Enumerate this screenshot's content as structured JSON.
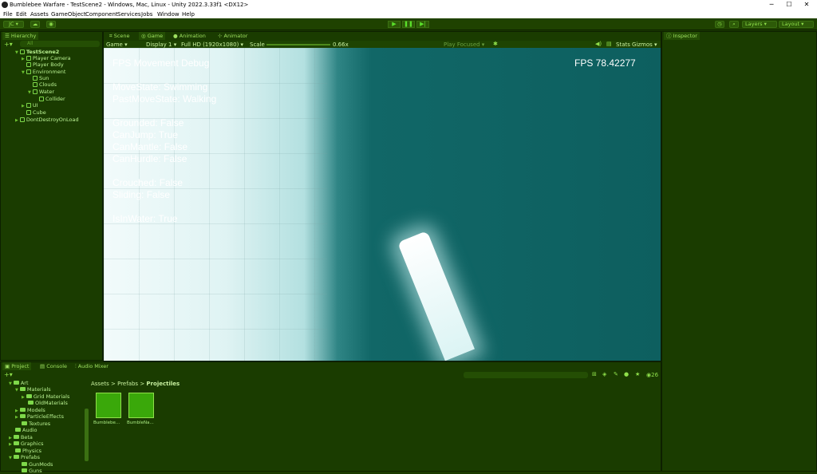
{
  "window": {
    "title": "Bumblebee Warfare - TestScene2 - Windows, Mac, Linux - Unity 2022.3.33f1 <DX12>",
    "min": "─",
    "max": "☐",
    "close": "✕"
  },
  "menu": [
    "File",
    "Edit",
    "Assets",
    "GameObject",
    "Component",
    "Services",
    "Jobs",
    "Window",
    "Help"
  ],
  "toolbar": {
    "account": "JC ▾",
    "layers": "Layers",
    "layout": "Layout"
  },
  "hierarchy": {
    "tab": "Hierarchy",
    "search": "All",
    "items": [
      "TestScene2",
      "Player Camera",
      "Player Body",
      "Environment",
      "Sun",
      "Clouds",
      "Water",
      "Collider",
      "UI",
      "Cube",
      "DontDestroyOnLoad"
    ]
  },
  "scene_tabs": [
    "Scene",
    "Game",
    "Animation",
    "Animator"
  ],
  "game_toolbar": {
    "mode": "Game",
    "display": "Display 1",
    "resolution": "Full HD (1920x1080)",
    "scale_label": "Scale",
    "scale_value": "0.66x",
    "play_focused": "Play Focused",
    "stats": "Stats",
    "gizmos": "Gizmos"
  },
  "debug": {
    "header": "FPS Movement Debug",
    "fps": "FPS 78.42277",
    "lines": [
      "MoveState: Swimming",
      "PastMoveState: Walking",
      "Grounded: False",
      "CanJump: True",
      "CanMantle: False",
      "CanHurdle: False",
      "Crouched: False",
      "Sliding: False",
      "IsInWater: True"
    ]
  },
  "inspector": {
    "tab": "Inspector"
  },
  "bottom_tabs": [
    "Project",
    "Console",
    "Audio Mixer"
  ],
  "project": {
    "tree": [
      "Art",
      "Materials",
      "Grid Materials",
      "OldMaterials",
      "Models",
      "ParticleEffects",
      "Textures",
      "Audio",
      "Beta",
      "Graphics",
      "Physics",
      "Prefabs",
      "GunMods",
      "Guns"
    ],
    "breadcrumb": [
      "Assets",
      "Prefabs",
      "Projectiles"
    ],
    "assets": [
      "Bumblebe...",
      "BumbleNa..."
    ],
    "count": "26"
  },
  "colors": {
    "accent": "#5ae02a",
    "panel": "#1a3c00",
    "sky_light": "#f2fbfb",
    "water": "#0d5f5f"
  }
}
